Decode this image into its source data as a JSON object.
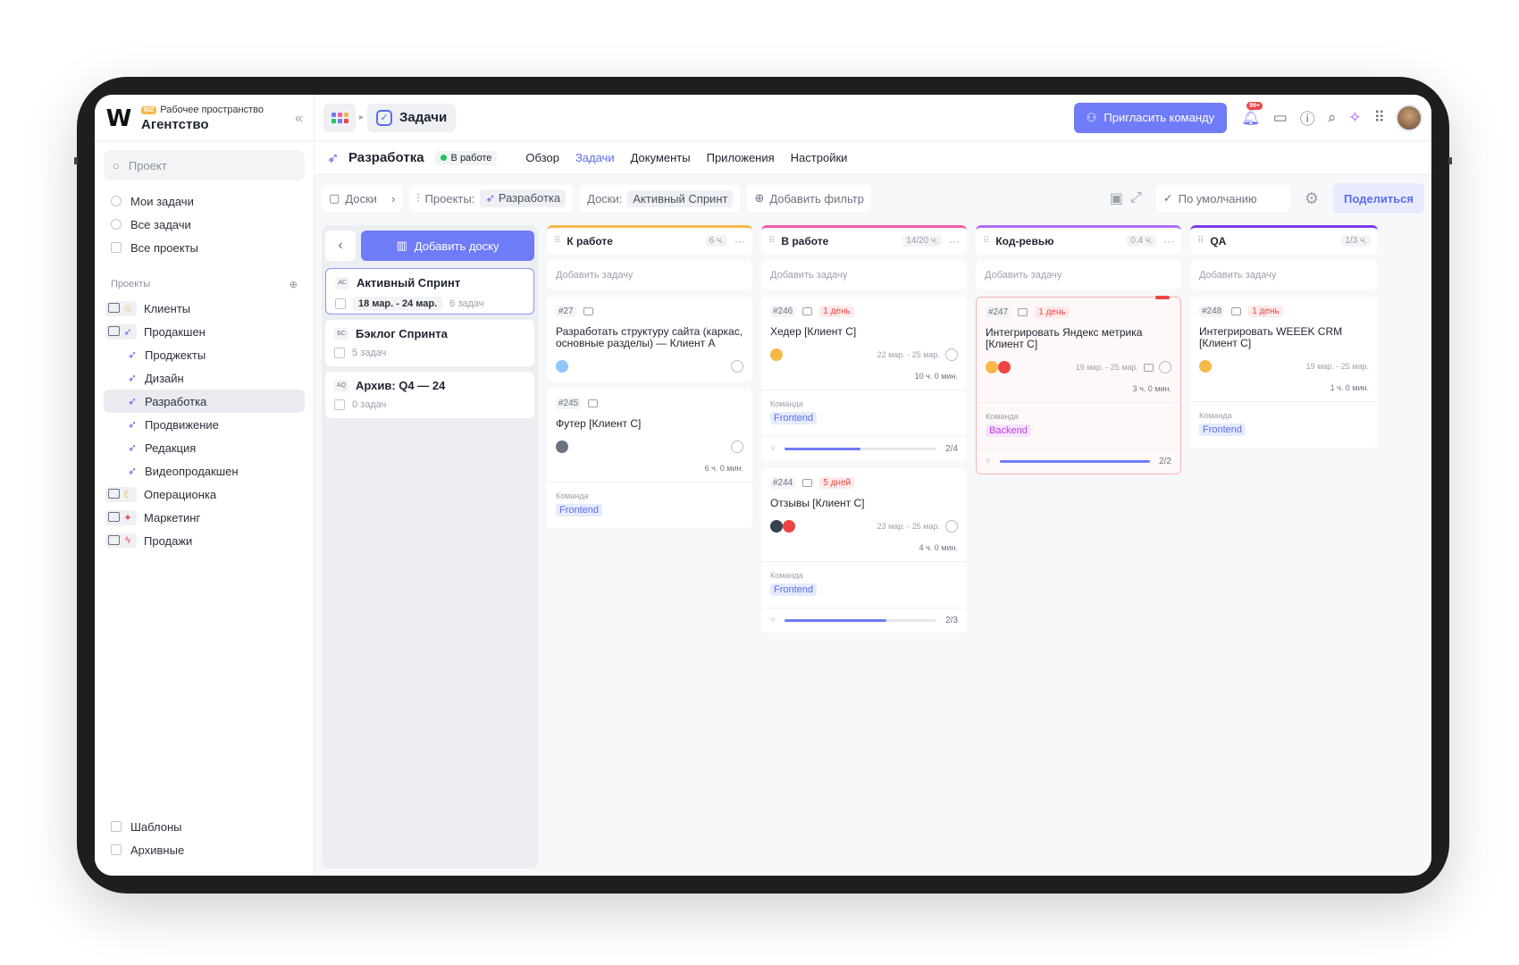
{
  "workspace": {
    "logo": "W",
    "badge": "BIZ",
    "subtitle": "Рабочее пространство",
    "name": "Агентство"
  },
  "sidebar": {
    "search_placeholder": "Проект",
    "main_items": [
      {
        "label": "Мои задачи"
      },
      {
        "label": "Все задачи"
      },
      {
        "label": "Все проекты"
      }
    ],
    "projects_label": "Проекты",
    "folders": [
      {
        "label": "Клиенты",
        "glyph": "☆",
        "color": "#f5a623"
      },
      {
        "label": "Продакшен",
        "glyph": "⚲",
        "color": "#6b5cf0"
      }
    ],
    "sub_projects": [
      {
        "label": "Проджекты"
      },
      {
        "label": "Дизайн"
      },
      {
        "label": "Разработка"
      },
      {
        "label": "Продвижение"
      },
      {
        "label": "Редакция"
      },
      {
        "label": "Видеопродакшен"
      }
    ],
    "more_folders": [
      {
        "label": "Операционка",
        "glyph": "☾",
        "color": "#f5a623"
      },
      {
        "label": "Маркетинг",
        "glyph": "✦",
        "color": "#ef4444"
      },
      {
        "label": "Продажи",
        "glyph": "ϟ",
        "color": "#ef4444"
      }
    ],
    "templates": "Шаблоны",
    "archived": "Архивные"
  },
  "topbar": {
    "tab_label": "Задачи",
    "invite_label": "Пригласить команду",
    "notif_count": "99+"
  },
  "project": {
    "title": "Разработка",
    "status": "В работе",
    "tabs": [
      "Обзор",
      "Задачи",
      "Документы",
      "Приложения",
      "Настройки"
    ],
    "active_tab": "Задачи"
  },
  "filters": {
    "boards_label": "Доски",
    "projects_label": "Проекты:",
    "projects_value": "Разработка",
    "boards_filter_label": "Доски:",
    "boards_filter_value": "Активный Спринт",
    "add_filter": "Добавить фильтр",
    "sort_label": "По умолчанию",
    "share_label": "Поделиться"
  },
  "boards_panel": {
    "add_label": "Добавить доску",
    "boards": [
      {
        "abbr": "АС",
        "title": "Активный Спринт",
        "date": "18 мар. - 24 мар.",
        "count": "6 задач"
      },
      {
        "abbr": "БС",
        "title": "Бэклог Спринта",
        "count": "5 задач"
      },
      {
        "abbr": "AQ",
        "title": "Архив: Q4 — 24",
        "count": "0 задач"
      }
    ]
  },
  "add_task_label": "Добавить задачу",
  "team_label": "Команда",
  "columns": [
    {
      "name": "К работе",
      "hours": "6 ч.",
      "color": "#f5b94a",
      "tasks": [
        {
          "id": "#27",
          "title": "Разработать структуру сайта (каркас, основные разделы) — Клиент А"
        },
        {
          "id": "#245",
          "title": "Футер [Клиент С]",
          "time": "6 ч. 0 мин.",
          "team": "Frontend"
        }
      ]
    },
    {
      "name": "В работе",
      "hours": "14/20 ч.",
      "color": "#ef5da8",
      "tasks": [
        {
          "id": "#246",
          "due": "1 день",
          "title": "Хедер [Клиент С]",
          "dates": "22 мар. - 25 мар.",
          "time": "10 ч. 0 мин.",
          "team": "Frontend",
          "progress": "2/4",
          "progress_value": 0.5
        },
        {
          "id": "#244",
          "due": "5 дней",
          "title": "Отзывы [Клиент С]",
          "dates": "23 мар. - 25 мар.",
          "time": "4 ч. 0 мин.",
          "team": "Frontend",
          "progress": "2/3",
          "progress_value": 0.67
        }
      ]
    },
    {
      "name": "Код-ревью",
      "hours": "0.4 ч.",
      "color": "#b06cf0",
      "tasks": [
        {
          "id": "#247",
          "due": "1 день",
          "title": "Интегрировать Яндекс метрика [Клиент С]",
          "dates": "19 мар. - 25 мар.",
          "time": "3 ч. 0 мин.",
          "team": "Backend",
          "progress": "2/2",
          "progress_value": 1.0
        }
      ]
    },
    {
      "name": "QA",
      "hours": "1/3 ч.",
      "color": "#7c3aed",
      "tasks": [
        {
          "id": "#248",
          "due": "1 день",
          "title": "Интегрировать WEEEK CRM [Клиент С]",
          "dates": "19 мар. - 25 мар.",
          "time": "1 ч. 0 мин.",
          "team": "Frontend"
        }
      ]
    }
  ]
}
